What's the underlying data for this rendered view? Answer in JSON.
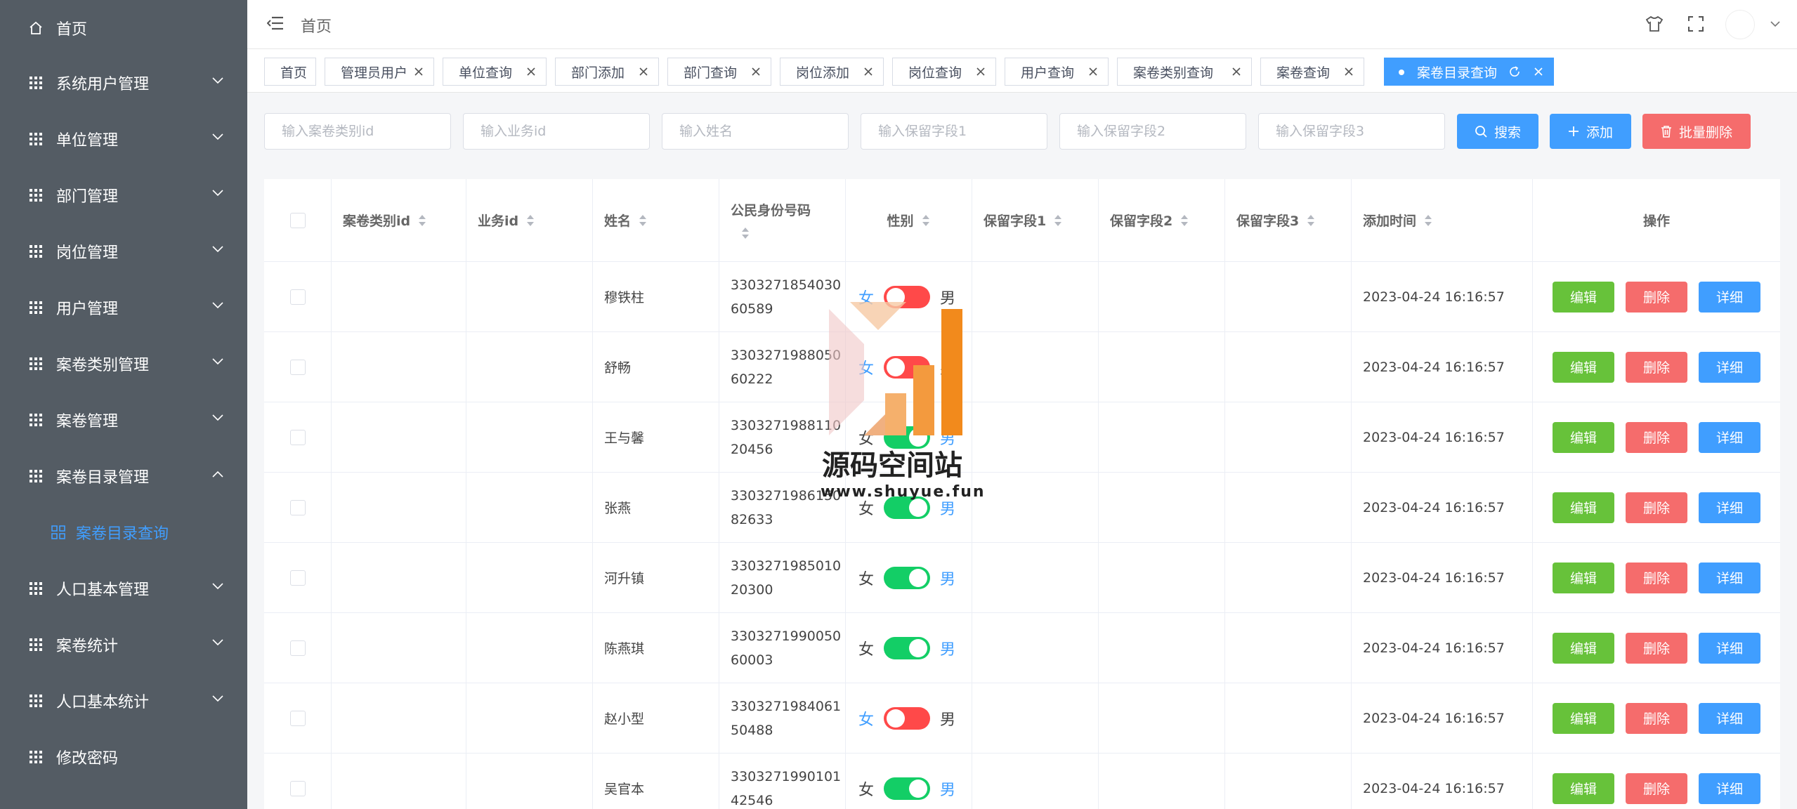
{
  "sidebar": {
    "items": [
      {
        "label": "首页"
      },
      {
        "label": "系统用户管理"
      },
      {
        "label": "单位管理"
      },
      {
        "label": "部门管理"
      },
      {
        "label": "岗位管理"
      },
      {
        "label": "用户管理"
      },
      {
        "label": "案卷类别管理"
      },
      {
        "label": "案卷管理"
      },
      {
        "label": "案卷目录管理"
      },
      {
        "label": "案卷目录查询"
      },
      {
        "label": "人口基本管理"
      },
      {
        "label": "案卷统计"
      },
      {
        "label": "人口基本统计"
      },
      {
        "label": "修改密码"
      }
    ]
  },
  "header": {
    "breadcrumb": "首页"
  },
  "tabs": [
    {
      "label": "首页"
    },
    {
      "label": "管理员用户"
    },
    {
      "label": "单位查询"
    },
    {
      "label": "部门添加"
    },
    {
      "label": "部门查询"
    },
    {
      "label": "岗位添加"
    },
    {
      "label": "岗位查询"
    },
    {
      "label": "用户查询"
    },
    {
      "label": "案卷类别查询"
    },
    {
      "label": "案卷查询"
    },
    {
      "label": "案卷目录查询"
    }
  ],
  "search": {
    "placeholders": [
      "输入案卷类别id",
      "输入业务id",
      "输入姓名",
      "输入保留字段1",
      "输入保留字段2",
      "输入保留字段3"
    ],
    "search_label": "搜索",
    "add_label": "添加",
    "batch_delete_label": "批量删除"
  },
  "table": {
    "columns": [
      "案卷类别id",
      "业务id",
      "姓名",
      "公民身份号码",
      "性别",
      "保留字段1",
      "保留字段2",
      "保留字段3",
      "添加时间",
      "操作"
    ],
    "gender_female": "女",
    "gender_male": "男",
    "op_edit": "编辑",
    "op_delete": "删除",
    "op_detail": "详细",
    "rows": [
      {
        "name": "穆铁柱",
        "id1": "3303271854030",
        "id2": "60589",
        "gender": "female",
        "time": "2023-04-24 16:16:57"
      },
      {
        "name": "舒畅",
        "id1": "3303271988050",
        "id2": "60222",
        "gender": "female",
        "time": "2023-04-24 16:16:57"
      },
      {
        "name": "王与馨",
        "id1": "3303271988110",
        "id2": "20456",
        "gender": "male",
        "time": "2023-04-24 16:16:57"
      },
      {
        "name": "张燕",
        "id1": "3303271986150",
        "id2": "82633",
        "gender": "male",
        "time": "2023-04-24 16:16:57"
      },
      {
        "name": "河升镇",
        "id1": "3303271985010",
        "id2": "20300",
        "gender": "male",
        "time": "2023-04-24 16:16:57"
      },
      {
        "name": "陈燕琪",
        "id1": "3303271990050",
        "id2": "60003",
        "gender": "male",
        "time": "2023-04-24 16:16:57"
      },
      {
        "name": "赵小型",
        "id1": "3303271984061",
        "id2": "50488",
        "gender": "female",
        "time": "2023-04-24 16:16:57"
      },
      {
        "name": "吴官本",
        "id1": "3303271990101",
        "id2": "42546",
        "gender": "male",
        "time": "2023-04-24 16:16:57"
      }
    ]
  },
  "watermark": {
    "title": "源码空间站",
    "url": "www.shuyue.fun"
  },
  "colors": {
    "sidebar_bg": "#545c64",
    "primary": "#409eff",
    "danger": "#f56c6c",
    "success": "#67c23a",
    "switch_off": "#ff4949",
    "switch_on": "#13ce66"
  }
}
